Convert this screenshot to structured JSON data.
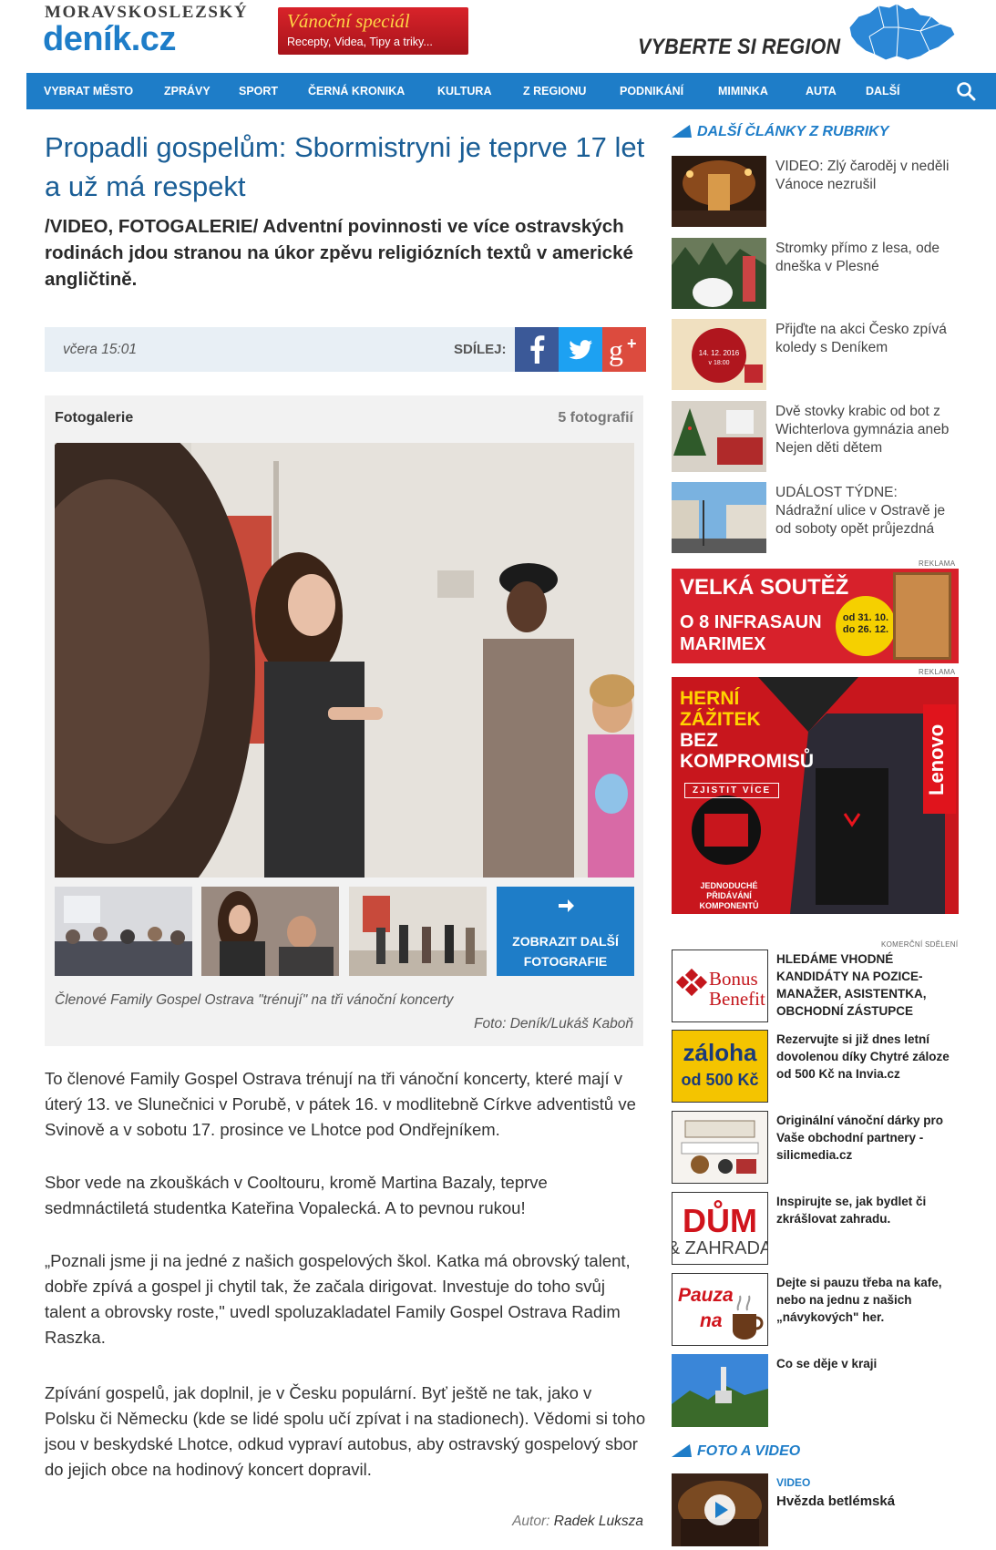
{
  "header": {
    "logo_top": "MORAVSKOSLEZSKÝ",
    "logo_main": "deník.cz",
    "promo_title": "Vánoční speciál",
    "promo_sub": "Recepty, Videa, Tipy a triky...",
    "region_text": "VYBERTE SI REGION"
  },
  "nav": {
    "items": [
      "VYBRAT MĚSTO",
      "ZPRÁVY",
      "SPORT",
      "ČERNÁ KRONIKA",
      "KULTURA",
      "Z REGIONU",
      "PODNIKÁNÍ",
      "MIMINKA",
      "AUTA",
      "DALŠÍ"
    ]
  },
  "article": {
    "title": "Propadli gospelům: Sbormistryni je teprve 17 let a už má respekt",
    "lead": "/VIDEO, FOTOGALERIE/ Adventní povinnosti ve více ostravských rodinách jdou stranou na úkor zpěvu religiózních textů v americké angličtině.",
    "time": "včera 15:01",
    "share_label": "SDÍLEJ:",
    "gallery": {
      "label": "Fotogalerie",
      "count": "5 fotografií",
      "more_label_1": "ZOBRAZIT DALŠÍ",
      "more_label_2": "FOTOGRAFIE",
      "caption": "Členové Family Gospel Ostrava \"trénují\" na tři vánoční koncerty",
      "credit": "Foto: Deník/Lukáš Kaboň"
    },
    "paragraphs": [
      "To členové Family Gospel Ostrava trénují na tři vánoční koncerty, které mají v úterý 13. ve Slunečnici v Porubě, v pátek 16. v modlitebně Církve adventistů ve Svinově a v sobotu 17. prosince ve Lhotce pod Ondřejníkem.",
      "Sbor vede na zkouškách v Cooltouru, kromě Martina Bazaly, teprve sedmnáctiletá studentka Kateřina Vopalecká. A to pevnou rukou!",
      "„Poznali jsme ji na jedné z našich gospelových škol. Katka má obrovský talent, dobře zpívá a gospel ji chytil tak, že začala dirigovat. Investuje do toho svůj talent a obrovsky roste,\" uvedl spoluzakladatel Family Gospel Ostrava Radim Raszka.",
      "Zpívání gospelů, jak doplnil, je v Česku populární. Byť ještě ne tak, jako v Polsku či Německu (kde se lidé spolu učí zpívat i na stadionech). Vědomi si toho jsou v beskydské Lhotce, odkud vypraví autobus, aby ostravský gospelový sbor do jejich obce na hodinový koncert dopravil."
    ],
    "author_label": "Autor:",
    "author_name": "Radek Luksza"
  },
  "sidebar": {
    "related_heading": "DALŠÍ ČLÁNKY Z RUBRIKY",
    "related": [
      "VIDEO: Zlý čaroděj v neděli Vánoce nezrušil",
      "Stromky přímo z lesa, ode dneška v Plesné",
      "Přijďte na akci Česko zpívá koledy s Deníkem",
      "Dvě stovky krabic od bot z Wichterlova gymnázia aneb Nejen děti dětem",
      "UDÁLOST TÝDNE: Nádražní ulice v Ostravě je od soboty opět průjezdná"
    ],
    "reklama": "REKLAMA",
    "ad1": {
      "title": "VELKÁ SOUTĚŽ",
      "line1": "O 8 INFRASAUN",
      "line2": "MARIMEX",
      "badge1": "od 31. 10.",
      "badge2": "do 26. 12."
    },
    "ad2": {
      "line1": "HERNÍ",
      "line2": "ZÁŽITEK",
      "line3": "BEZ",
      "line4": "KOMPROMISŮ",
      "cta": "ZJISTIT VÍCE",
      "brand": "Lenovo",
      "foot1": "JEDNODUCHÉ",
      "foot2": "PŘIDÁVÁNÍ KOMPONENTŮ"
    },
    "commercial_label": "KOMERČNÍ SDĚLENÍ",
    "commercial": [
      {
        "logo1": "Bonus",
        "logo2": "Benefit",
        "text": "HLEDÁME VHODNÉ KANDIDÁTY NA POZICE- MANAŽER, ASISTENTKA, OBCHODNÍ ZÁSTUPCE"
      },
      {
        "logo1": "záloha",
        "logo2": "od 500 Kč",
        "text": "Rezervujte si již dnes letní dovolenou díky Chytré záloze od 500 Kč na Invia.cz"
      },
      {
        "text": "Originální vánoční dárky pro Vaše obchodní partnery - silicmedia.cz"
      },
      {
        "logo1": "DŮM",
        "logo2": "& ZAHRADA",
        "text": "Inspirujte se, jak bydlet či zkrášlovat zahradu."
      },
      {
        "logo1": "Pauza",
        "logo2": "na",
        "text": "Dejte si pauzu třeba na kafe, nebo na jednu z našich „návykových\" her."
      },
      {
        "text": "Co se děje v kraji"
      }
    ],
    "video_heading": "FOTO A VIDEO",
    "video_label": "VIDEO",
    "video_title": "Hvězda betlémská"
  }
}
